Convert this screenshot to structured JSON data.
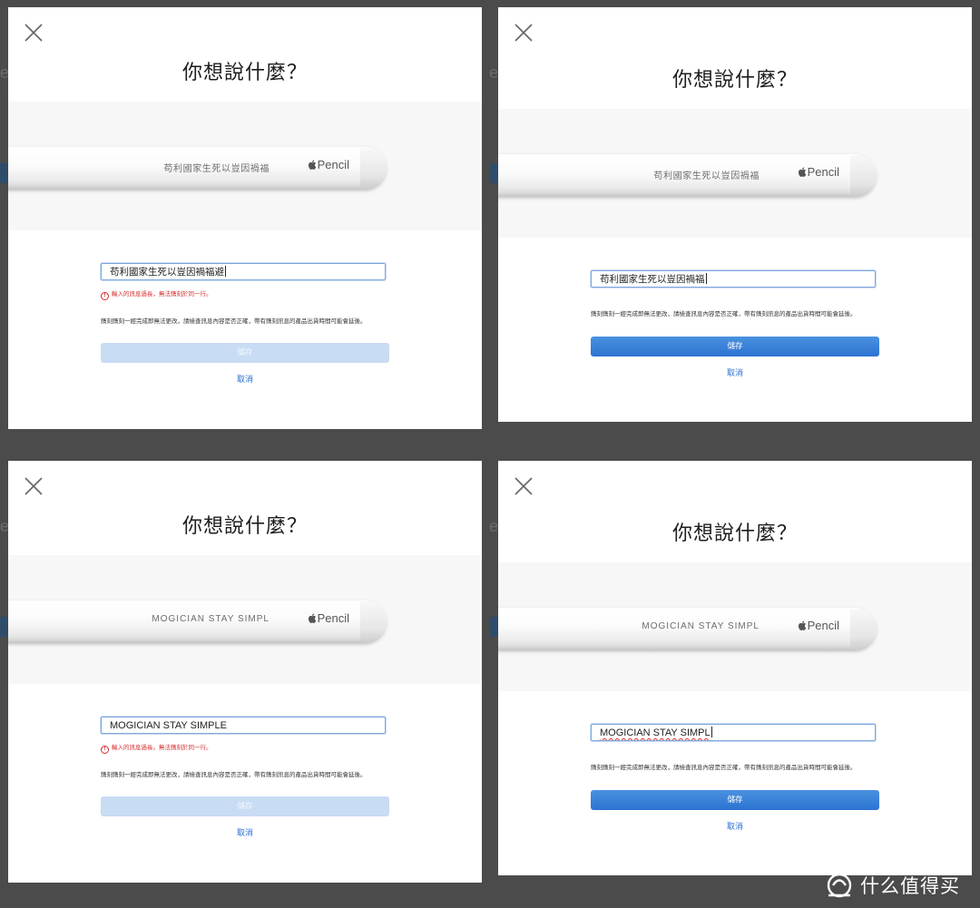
{
  "panels": [
    {
      "id": "top-left",
      "title": "你想說什麼？",
      "engraving": "苟利國家生死以豈因禍福",
      "brand": "Pencil",
      "input_value": "苟利國家生死以豈因禍福避",
      "error": "輸入的訊息過長，無法鐫刻於同一行。",
      "error_icon": "!",
      "note": "鐫刻鐫刻一經完成即無法更改，請檢查訊息內容是否正確，帶有鐫刻訊息的產品出貨時間可能會延後。",
      "save_label": "儲存",
      "save_state": "disabled",
      "cancel_label": "取消"
    },
    {
      "id": "top-right",
      "title": "你想說什麼？",
      "engraving": "苟利國家生死以豈因禍福",
      "brand": "Pencil",
      "input_value": "苟利國家生死以豈因禍福",
      "error": "",
      "note": "鐫刻鐫刻一經完成即無法更改，請檢查訊息內容是否正確，帶有鐫刻訊息的產品出貨時間可能會延後。",
      "save_label": "儲存",
      "save_state": "enabled",
      "cancel_label": "取消"
    },
    {
      "id": "bottom-left",
      "title": "你想說什麼？",
      "engraving": "MOGICIAN STAY SIMPL",
      "brand": "Pencil",
      "input_value": "MOGICIAN STAY SIMPLE",
      "error": "輸入的訊息過長，無法鐫刻於同一行。",
      "error_icon": "!",
      "note": "鐫刻鐫刻一經完成即無法更改，請檢查訊息內容是否正確，帶有鐫刻訊息的產品出貨時間可能會延後。",
      "save_label": "儲存",
      "save_state": "disabled",
      "cancel_label": "取消"
    },
    {
      "id": "bottom-right",
      "title": "你想說什麼？",
      "engraving": "MOGICIAN STAY SIMPL",
      "brand": "Pencil",
      "input_value": "MOGICIAN STAY SIMPL",
      "error": "",
      "note": "鐫刻鐫刻一經完成即無法更改，請檢查訊息內容是否正確，帶有鐫刻訊息的產品出貨時間可能會延後。",
      "save_label": "儲存",
      "save_state": "enabled",
      "cancel_label": "取消"
    }
  ],
  "watermark": {
    "text": "什么值得买",
    "icon": "smzdm-logo"
  },
  "colors": {
    "accent": "#2c73d1",
    "accent_disabled": "#c8dcf3",
    "error": "#d62b2b",
    "backdrop": "#4b4b4b"
  }
}
